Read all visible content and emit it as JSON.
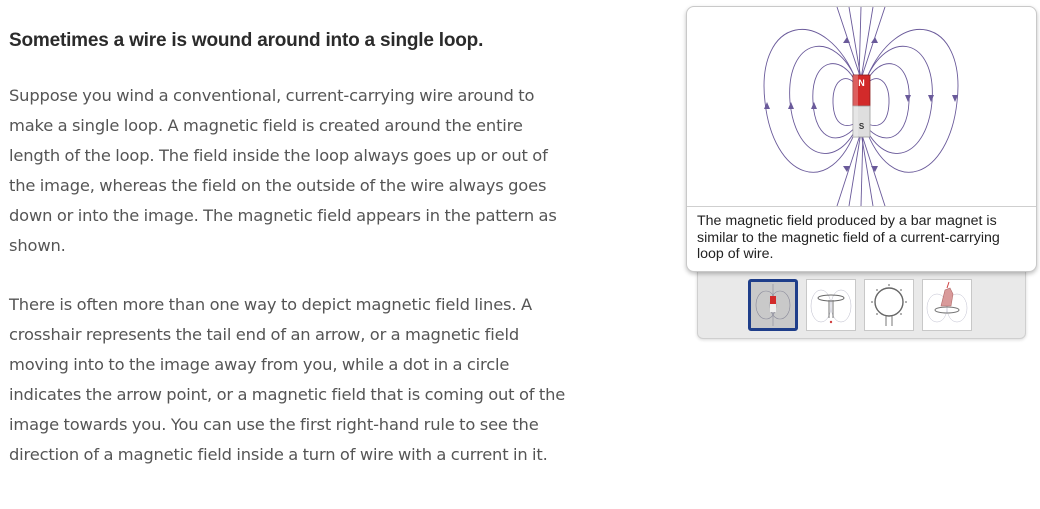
{
  "article": {
    "heading": "Sometimes a wire is wound around into a single loop.",
    "paragraph1": "Suppose you wind a conventional, current-carrying wire around to make a single loop. A magnetic field is created around the entire length of the loop. The field inside the loop always goes up or out of the image, whereas the field on the outside of the wire always goes down or into the image. The magnetic field appears in the pattern as shown.",
    "paragraph2": "There is often more than one way to depict magnetic field lines. A crosshair represents the tail end of an arrow, or a magnetic field moving into to the image away from you, while a dot in a circle indicates the arrow point, or a magnetic field that is coming out of the image towards you. You can use the first right-hand rule to see the direction of a magnetic field inside a turn of wire with a current in it."
  },
  "figure": {
    "magnet_north_label": "N",
    "magnet_south_label": "S",
    "caption": "The magnetic field produced by a bar magnet is similar to the magnetic field of a current-carrying loop of wire.",
    "colors": {
      "field_lines": "#6a5a9a",
      "magnet_north": "#d22a2a",
      "magnet_south": "#d8d8d8",
      "active_thumb_border": "#1f3e8a"
    }
  },
  "gallery": {
    "thumbnails": [
      {
        "name": "bar-magnet-field",
        "active": true
      },
      {
        "name": "current-loop-field",
        "active": false
      },
      {
        "name": "wire-ring-field",
        "active": false
      },
      {
        "name": "hand-rule-loop",
        "active": false
      }
    ]
  }
}
